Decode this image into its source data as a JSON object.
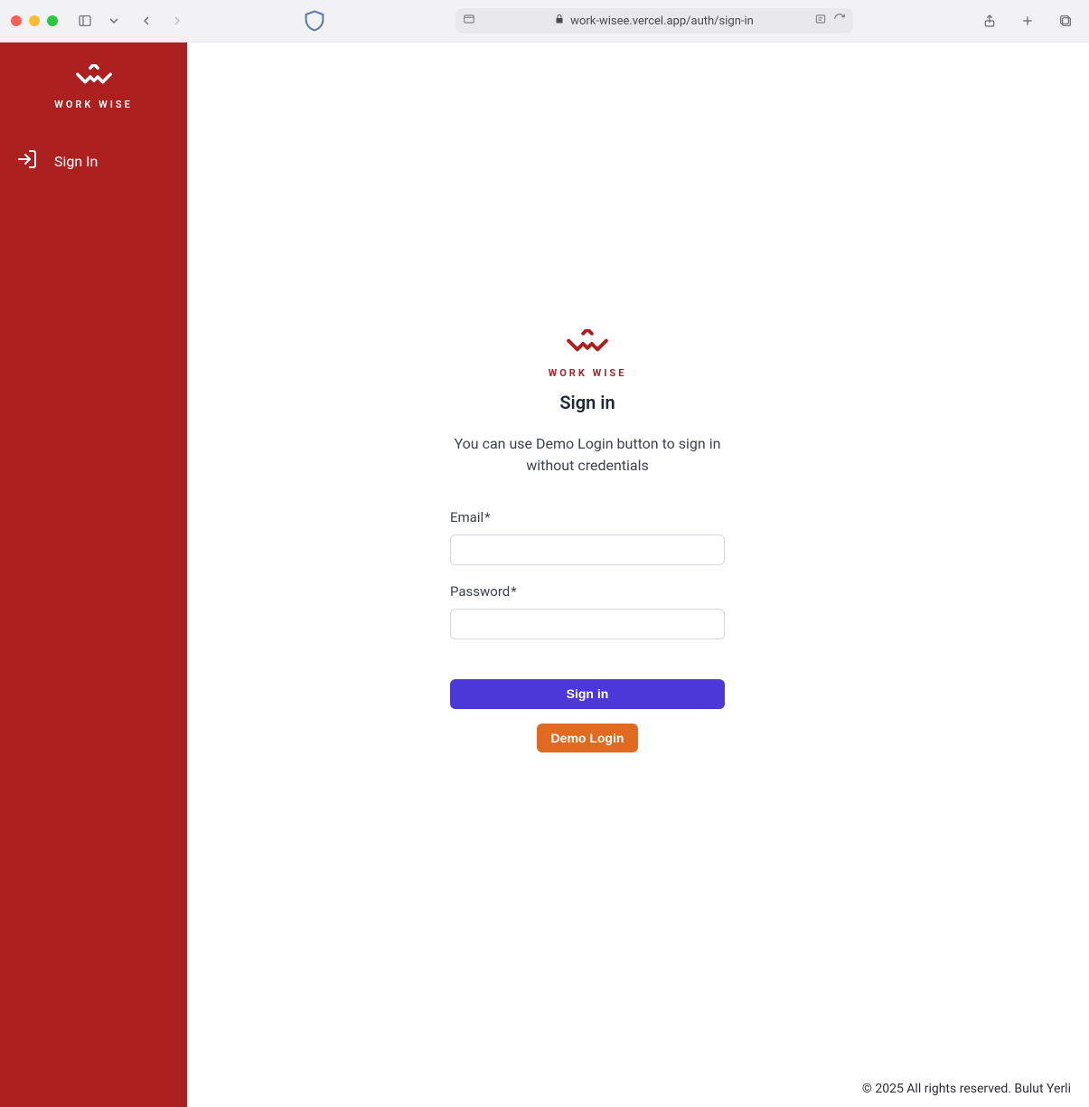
{
  "browser": {
    "url": "work-wisee.vercel.app/auth/sign-in"
  },
  "sidebar": {
    "brand": "WORK WISE",
    "nav": [
      {
        "label": "Sign In"
      }
    ]
  },
  "main": {
    "brand": "WORK WISE",
    "title": "Sign in",
    "subtitle": "You can use Demo Login button to sign in without credentials",
    "email_label": "Email",
    "password_label": "Password",
    "required_mark": "*",
    "signin_button": "Sign in",
    "demo_button": "Demo Login",
    "email_value": "",
    "password_value": ""
  },
  "footer": {
    "text": "© 2025 All rights reserved. Bulut Yerli"
  },
  "colors": {
    "brand_red": "#ac2020",
    "primary_button": "#4c38d9",
    "demo_button": "#e06a20"
  }
}
